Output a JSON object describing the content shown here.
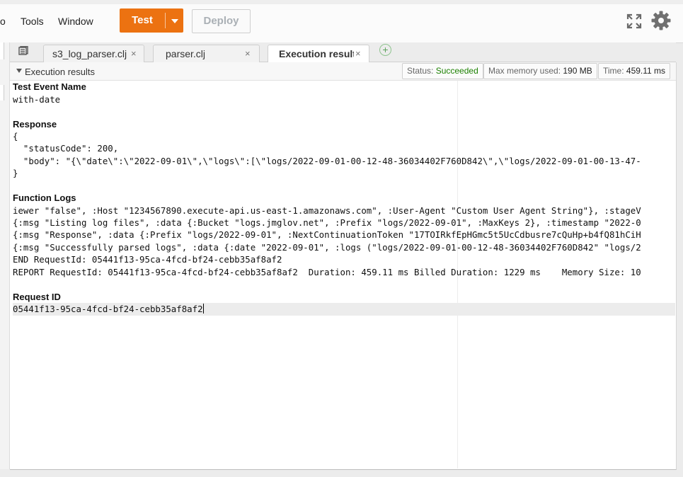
{
  "menu": {
    "partial": "o",
    "tools": "Tools",
    "window": "Window"
  },
  "toolbar": {
    "test_label": "Test",
    "deploy_label": "Deploy"
  },
  "tabs": [
    {
      "label": "s3_log_parser.clj",
      "active": false
    },
    {
      "label": "parser.clj",
      "active": false
    },
    {
      "label": "Execution results",
      "active": true
    }
  ],
  "tab_close_glyph": "×",
  "add_tab_glyph": "+",
  "panel": {
    "title": "Execution results",
    "status_label": "Status:",
    "status_value": "Succeeded",
    "memory_label": "Max memory used:",
    "memory_value": "190 MB",
    "time_label": "Time:",
    "time_value": "459.11 ms"
  },
  "result": {
    "test_event_title": "Test Event Name",
    "test_event_value": "with-date",
    "response_title": "Response",
    "response_lines": [
      "{",
      "  \"statusCode\": 200,",
      "  \"body\": \"{\\\"date\\\":\\\"2022-09-01\\\",\\\"logs\\\":[\\\"logs/2022-09-01-00-12-48-36034402F760D842\\\",\\\"logs/2022-09-01-00-13-47-",
      "}"
    ],
    "function_logs_title": "Function Logs",
    "log_lines": [
      "iewer \"false\", :Host \"1234567890.execute-api.us-east-1.amazonaws.com\", :User-Agent \"Custom User Agent String\"}, :stageV",
      "{:msg \"Listing log files\", :data {:Bucket \"logs.jmglov.net\", :Prefix \"logs/2022-09-01\", :MaxKeys 2}, :timestamp \"2022-0",
      "{:msg \"Response\", :data {:Prefix \"logs/2022-09-01\", :NextContinuationToken \"17TOIRkfEpHGmc5t5UcCdbusre7cQuHp+b4fQ81hCiH",
      "{:msg \"Successfully parsed logs\", :data {:date \"2022-09-01\", :logs (\"logs/2022-09-01-00-12-48-36034402F760D842\" \"logs/2",
      "END RequestId: 05441f13-95ca-4fcd-bf24-cebb35af8af2",
      "REPORT RequestId: 05441f13-95ca-4fcd-bf24-cebb35af8af2  Duration: 459.11 ms Billed Duration: 1229 ms    Memory Size: 10"
    ],
    "request_id_title": "Request ID",
    "request_id_value": "05441f13-95ca-4fcd-bf24-cebb35af8af2"
  },
  "colors": {
    "accent": "#ec7211",
    "success": "#1d8102"
  },
  "icons": [
    "fullscreen-icon",
    "gear-icon",
    "tabs-menu-icon",
    "close-icon",
    "add-tab-icon",
    "collapse-triangle-icon"
  ]
}
